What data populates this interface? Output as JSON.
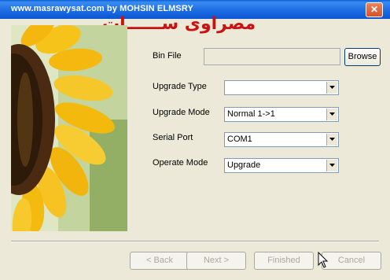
{
  "window": {
    "title": "www.masrawysat.com by MOHSIN ELMSRY",
    "close_glyph": "✕",
    "overlay_text": "مصراوى ســــــات"
  },
  "form": {
    "bin_file_label": "Bin File",
    "bin_file_value": "",
    "browse_label": "Browse",
    "upgrade_type_label": "Upgrade Type",
    "upgrade_type_value": "",
    "upgrade_mode_label": "Upgrade Mode",
    "upgrade_mode_value": "Normal 1->1",
    "serial_port_label": "Serial Port",
    "serial_port_value": "COM1",
    "operate_mode_label": "Operate Mode",
    "operate_mode_value": "Upgrade"
  },
  "buttons": {
    "back": "< Back",
    "next": "Next >",
    "finished": "Finished",
    "cancel": "Cancel"
  },
  "icons": {
    "close": "close-icon",
    "dropdown": "chevron-down-icon",
    "cursor": "mouse-pointer-icon",
    "image": "sunflower-image"
  }
}
